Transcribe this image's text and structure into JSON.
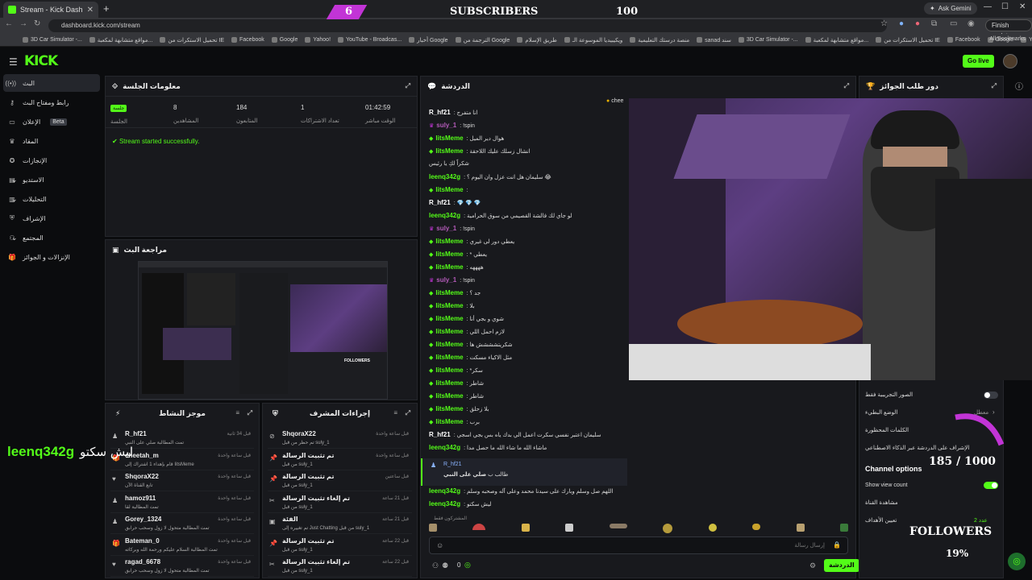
{
  "browser": {
    "tab_title": "Stream - Kick Dashboard",
    "url": "dashboard.kick.com/stream",
    "ask_gemini": "Ask Gemini",
    "finish_update": "Finish update",
    "all_bookmarks": "All Bookmarks",
    "bookmarks": [
      "3D Car Simulator -...",
      "مواقع متشابهة لمكعبة...",
      "تحميل الاستكرات من IE",
      "Facebook",
      "Google",
      "Yahoo!",
      "YouTube - Broadcas...",
      "أخبار Google",
      "الترجمة من Google",
      "طريق الإسلام",
      "ويكيبيديا الموسوعة الـ",
      "منصة درستك التعليمية",
      "sanad سند",
      "3D Car Simulator -...",
      "مواقع متشابهة لمكعبة...",
      "تحميل الاستكرات من IE",
      "Facebook",
      "Google",
      "Yahoo!"
    ]
  },
  "header": {
    "logo": "KICK",
    "go_live": "Go live"
  },
  "sidebar": {
    "items": [
      {
        "label": "البث",
        "icon": "broadcast-icon"
      },
      {
        "label": "رابط ومفتاح البث",
        "icon": "key-icon"
      },
      {
        "label": "الإعلان",
        "icon": "ad-icon",
        "badge": "Beta"
      },
      {
        "label": "المقاد",
        "icon": "trophy-icon"
      },
      {
        "label": "الإنجازات",
        "icon": "badge-icon"
      },
      {
        "label": "الاستديو",
        "icon": "studio-icon"
      },
      {
        "label": "التحليلات",
        "icon": "analytics-icon"
      },
      {
        "label": "الإشراف",
        "icon": "shield-icon"
      },
      {
        "label": "المجتمع",
        "icon": "community-icon"
      },
      {
        "label": "الإنزالات و الجوائز",
        "icon": "gift-icon"
      }
    ]
  },
  "session": {
    "title": "معلومات الجلسة",
    "stats": [
      {
        "value": "01:42:59",
        "label": "الوقت مباشر"
      },
      {
        "value": "1",
        "label": "تعداد الاشتراكات"
      },
      {
        "value": "184",
        "label": "المتابعون"
      },
      {
        "value": "8",
        "label": "المشاهدين"
      },
      {
        "value": "جلسة",
        "label": "الجلسة"
      }
    ],
    "status": "Stream started successfully."
  },
  "preview": {
    "title": "مراجعة البث"
  },
  "activity": {
    "title": "موجز النشاط",
    "rows": [
      {
        "name": "R_hf21",
        "sub": "تمت المطالبة صلي على النبي",
        "time": "قبل 34 ثانية"
      },
      {
        "name": "cheetah_m",
        "sub": "قام بإهداء 1 اشتراك إلى IitsMeme",
        "time": "قبل ساعة واحدة"
      },
      {
        "name": "ShqoraX22",
        "sub": "تابع القناة الآن",
        "time": "قبل ساعة واحدة"
      },
      {
        "name": "hamoz911",
        "sub": "تمت المطالبة لقا",
        "time": "قبل ساعة واحدة"
      },
      {
        "name": "Gorey_1324",
        "sub": "تمت المطالبة متحول لا زول وسحب حرابق",
        "time": "قبل ساعة واحدة"
      },
      {
        "name": "Bateman_0",
        "sub": "تمت المطالبة السلام عليكم ورحمة الله وبركاته",
        "time": "قبل ساعة واحدة"
      },
      {
        "name": "ragad_6678",
        "sub": "تمت المطالبة متحول لا زول وسحب حرابق",
        "time": "قبل ساعة واحدة"
      }
    ]
  },
  "modactions": {
    "title": "إجراءات المشرف",
    "rows": [
      {
        "name": "ShqoraX22",
        "sub": "تم حظر من قبل suly_1",
        "time": "قبل ساعة واحدة"
      },
      {
        "name": "تم تثبيت الرسالة",
        "sub": "من قبل suly_1",
        "time": "قبل ساعة واحدة"
      },
      {
        "name": "تم تثبيت الرسالة",
        "sub": "من قبل suly_1",
        "time": "قبل ساعتين"
      },
      {
        "name": "تم إلغاء تثبيت الرسالة",
        "sub": "من قبل suly_1",
        "time": "قبل 21 ساعة"
      },
      {
        "name": "الفئة",
        "sub": "تم تغييره إلى Just Chatting من قبل suly_1",
        "time": "قبل 21 ساعة"
      },
      {
        "name": "تم تثبيت الرسالة",
        "sub": "من قبل suly_1",
        "time": "قبل 22 ساعة"
      },
      {
        "name": "تم إلغاء تثبيت الرسالة",
        "sub": "من قبل suly_1",
        "time": "قبل 22 ساعة"
      }
    ]
  },
  "chat": {
    "title": "الدردشة",
    "pinned_prefix": "chee",
    "messages": [
      {
        "user": "R_hf21",
        "text": "انا متفرج",
        "color": "r"
      },
      {
        "user": "suly_1",
        "text": "!spin",
        "color": "p",
        "badge": true
      },
      {
        "user": "IitsMeme",
        "text": "هوال دير الميل",
        "color": "g",
        "badge": true
      },
      {
        "user": "IitsMeme",
        "text": "انشال زسلك عليك اللاحقة",
        "color": "g",
        "badge": true
      },
      {
        "user": "",
        "text": "شكراً لكِ يا رئيس",
        "color": "r"
      },
      {
        "user": "leenq342g",
        "text": "سليمان هل انت عزل وان اليوم ؟ 😂",
        "color": "g"
      },
      {
        "user": "IitsMeme",
        "text": "",
        "color": "g",
        "badge": true
      },
      {
        "user": "R_hf21",
        "text": "💎 💎 💎",
        "color": "r"
      },
      {
        "user": "leenq342g",
        "text": "لو جاي لك فالشة القصيمي من سوق الحرامية",
        "color": "g"
      },
      {
        "user": "suly_1",
        "text": "!spin",
        "color": "p",
        "badge": true
      },
      {
        "user": "IitsMeme",
        "text": "يعطي دور لى غيري",
        "color": "g",
        "badge": true
      },
      {
        "user": "IitsMeme",
        "text": "* يعطي",
        "color": "g",
        "badge": true
      },
      {
        "user": "IitsMeme",
        "text": "ههههه",
        "color": "g",
        "badge": true
      },
      {
        "user": "suly_1",
        "text": "!spin",
        "color": "p",
        "badge": true
      },
      {
        "user": "IitsMeme",
        "text": "جد ؟",
        "color": "g",
        "badge": true
      },
      {
        "user": "IitsMeme",
        "text": "بلا",
        "color": "g",
        "badge": true
      },
      {
        "user": "IitsMeme",
        "text": "شوي و بجي أنا",
        "color": "g",
        "badge": true
      },
      {
        "user": "IitsMeme",
        "text": "لازم احمل اللي",
        "color": "g",
        "badge": true
      },
      {
        "user": "IitsMeme",
        "text": "شكريتشششش ها",
        "color": "g",
        "badge": true
      },
      {
        "user": "IitsMeme",
        "text": "مثل الاكياء مسكت",
        "color": "g",
        "badge": true
      },
      {
        "user": "IitsMeme",
        "text": "*سكر",
        "color": "g",
        "badge": true
      },
      {
        "user": "IitsMeme",
        "text": "شاطر",
        "color": "g",
        "badge": true
      },
      {
        "user": "IitsMeme",
        "text": "شاطر",
        "color": "g",
        "badge": true
      },
      {
        "user": "IitsMeme",
        "text": "بلا زحلق",
        "color": "g",
        "badge": true
      },
      {
        "user": "IitsMeme",
        "text": "برب",
        "color": "g",
        "badge": true
      },
      {
        "user": "R_hf21",
        "text": "سليمان اعتبر نفسي سكرت اعمل الي بدك ياه بس بجي اسجي",
        "color": "r"
      },
      {
        "user": "leenq342g",
        "text": "ماشاء الله ما شاء الله ما حصل مدا",
        "color": "g"
      }
    ],
    "reward_user": "R_hf21",
    "reward_label": "طالب ب",
    "reward_text": "صلي على النبي",
    "after": [
      {
        "user": "leenq342g",
        "text": "اللهم صل وسلم وبارك على سيدنا محمد وعلى آله وصحبه وسلم",
        "color": "g"
      },
      {
        "user": "leenq342g",
        "text": "ليش سكتو",
        "color": "g"
      }
    ],
    "emotes_label": "المشتركون فقط",
    "input_placeholder": "إرسال رسالة",
    "send_label": "الدردشة",
    "viewer_count": "0"
  },
  "settings": {
    "title": "دور طلب الجوائز",
    "lines": [
      {
        "label": "الصور التجريبية فقط",
        "toggle": "off"
      },
      {
        "label": "الوضع البطيء",
        "value": "معطل"
      },
      {
        "label": "الكلمات المحظورة",
        "value": ""
      },
      {
        "label": "الإشراف على الدردشة عبر الذكاء الاصطناعي",
        "value": ""
      }
    ],
    "channel_options": "Channel options",
    "show_view_count": "Show view count",
    "share_channel": "مشاهدة القناة",
    "goals": "تعيين الأهداف",
    "goals_value": "عدد 2"
  },
  "overlay": {
    "subs_num": "6",
    "subs_label": "SUBSCRIBERS",
    "subs_goal": "100",
    "chat_user": "leenq342g",
    "chat_msg": "ليش سكتو",
    "followers_count": "185 / 1000",
    "followers_label": "FOLLOWERS",
    "followers_pct": "19%"
  },
  "colors": {
    "accent": "#53fc18",
    "panel": "#18191d",
    "bg": "#0b0c0e"
  }
}
